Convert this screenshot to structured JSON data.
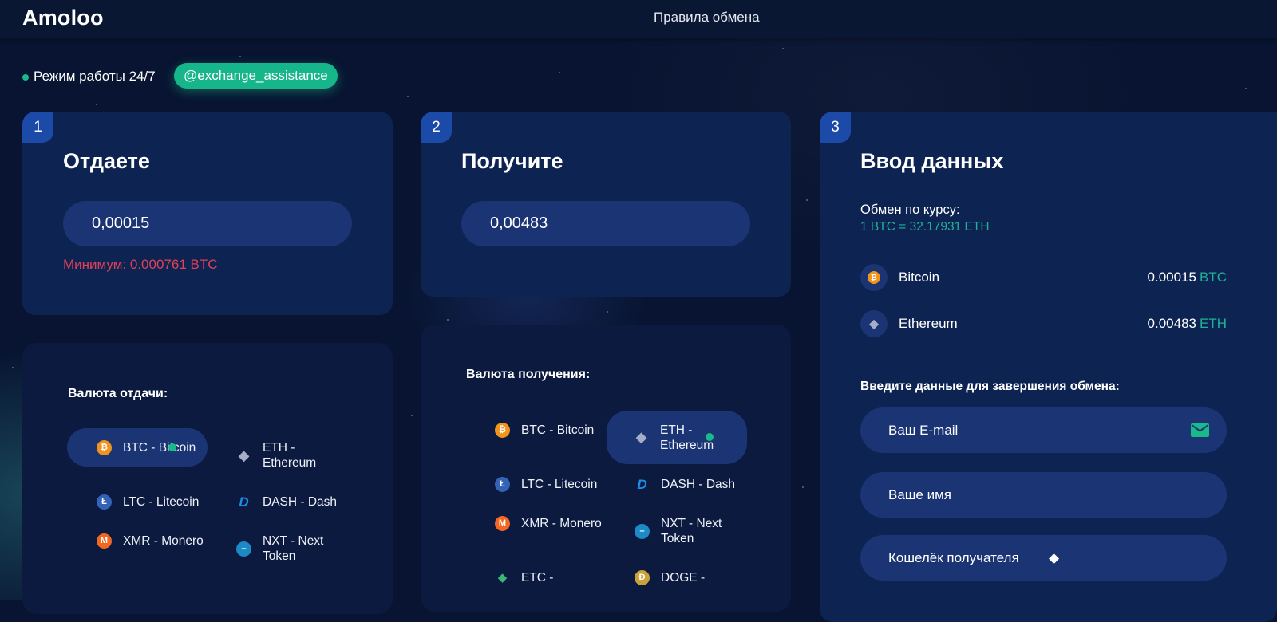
{
  "header": {
    "logo": "Amoloo",
    "rules_link": "Правила обмена"
  },
  "status": {
    "text": "Режим работы 24/7",
    "telegram": "@exchange_assistance"
  },
  "steps": {
    "give": {
      "number": "1",
      "title": "Отдаете",
      "amount": "0,00015",
      "minimum": "Минимум: 0.000761 BTC"
    },
    "receive": {
      "number": "2",
      "title": "Получите",
      "amount": "0,00483"
    },
    "details": {
      "number": "3",
      "title": "Ввод данных",
      "rate_label": "Обмен по курсу:",
      "rate_value": "1 BTC = 32.17931 ETH",
      "summary": [
        {
          "name": "Bitcoin",
          "amount": "0.00015",
          "currency": "BTC",
          "icon": "bitcoin-icon"
        },
        {
          "name": "Ethereum",
          "amount": "0.00483",
          "currency": "ETH",
          "icon": "ethereum-icon"
        }
      ],
      "complete_label": "Введите данные для завершения обмена:",
      "email_placeholder": "Ваш E-mail",
      "name_placeholder": "Ваше имя",
      "wallet_placeholder": "Кошелёк получателя"
    }
  },
  "give_list": {
    "title": "Валюта отдачи:",
    "selected": "BTC - Bitcoin",
    "coins": [
      {
        "label": "BTC - Bitcoin",
        "icon": "bitcoin-icon"
      },
      {
        "label": "ETH - Ethereum",
        "icon": "ethereum-icon"
      },
      {
        "label": "LTC - Litecoin",
        "icon": "litecoin-icon"
      },
      {
        "label": "DASH - Dash",
        "icon": "dash-icon"
      },
      {
        "label": "XMR - Monero",
        "icon": "monero-icon"
      },
      {
        "label": "NXT - Next Token",
        "icon": "nxt-icon"
      }
    ]
  },
  "receive_list": {
    "title": "Валюта получения:",
    "selected": "ETH - Ethereum",
    "coins": [
      {
        "label": "BTC - Bitcoin",
        "icon": "bitcoin-icon"
      },
      {
        "label": "ETH - Ethereum",
        "icon": "ethereum-icon"
      },
      {
        "label": "LTC - Litecoin",
        "icon": "litecoin-icon"
      },
      {
        "label": "DASH - Dash",
        "icon": "dash-icon"
      },
      {
        "label": "XMR - Monero",
        "icon": "monero-icon"
      },
      {
        "label": "NXT - Next Token",
        "icon": "nxt-icon"
      },
      {
        "label": "ETC -",
        "icon": "ethereum-classic-icon"
      },
      {
        "label": "DOGE -",
        "icon": "dogecoin-icon"
      }
    ]
  },
  "colors": {
    "accent": "#16b58a",
    "card": "#0d2352",
    "input": "#1b3473",
    "error": "#e0405a",
    "step_badge": "#1c4aa8"
  }
}
